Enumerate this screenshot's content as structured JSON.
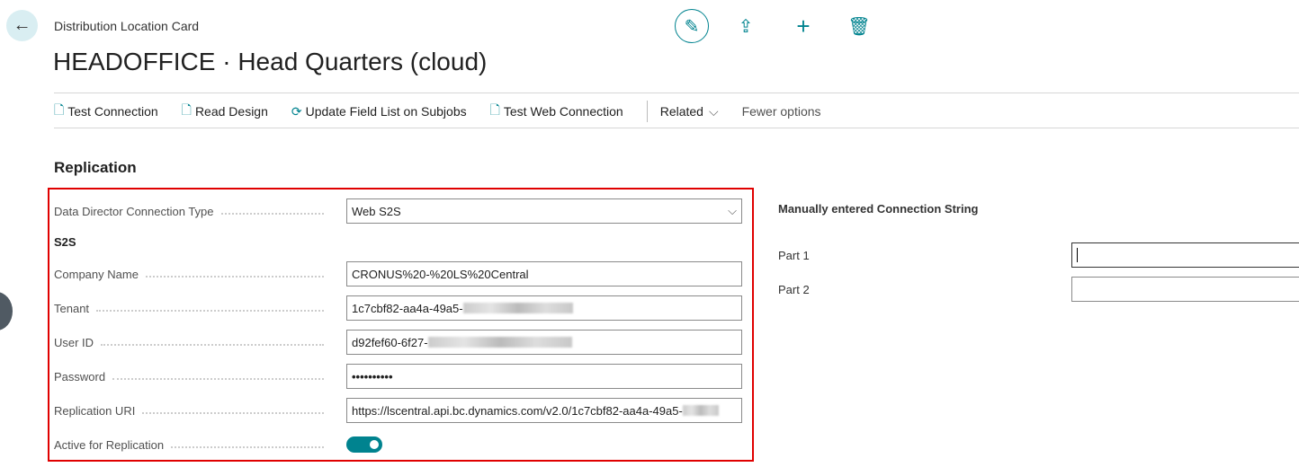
{
  "header": {
    "breadcrumb": "Distribution Location Card",
    "title": "HEADOFFICE · Head Quarters (cloud)"
  },
  "toolbar": {
    "actions": [
      "Test Connection",
      "Read Design",
      "Update Field List on Subjobs",
      "Test Web Connection"
    ],
    "related": "Related",
    "fewer": "Fewer options"
  },
  "section": {
    "title": "Replication",
    "subgroup": "S2S",
    "fields": {
      "conn_type": {
        "label": "Data Director Connection Type",
        "value": "Web S2S"
      },
      "company": {
        "label": "Company Name",
        "value": "CRONUS%20-%20LS%20Central"
      },
      "tenant": {
        "label": "Tenant",
        "value": "1c7cbf82-aa4a-49a5-"
      },
      "user": {
        "label": "User ID",
        "value": "d92fef60-6f27-"
      },
      "password": {
        "label": "Password",
        "value": "••••••••••"
      },
      "uri": {
        "label": "Replication URI",
        "value": "https://lscentral.api.bc.dynamics.com/v2.0/1c7cbf82-aa4a-49a5-"
      },
      "active": {
        "label": "Active for Replication",
        "value": true
      }
    }
  },
  "right": {
    "title": "Manually entered Connection String",
    "part1": "Part 1",
    "part2": "Part 2"
  }
}
